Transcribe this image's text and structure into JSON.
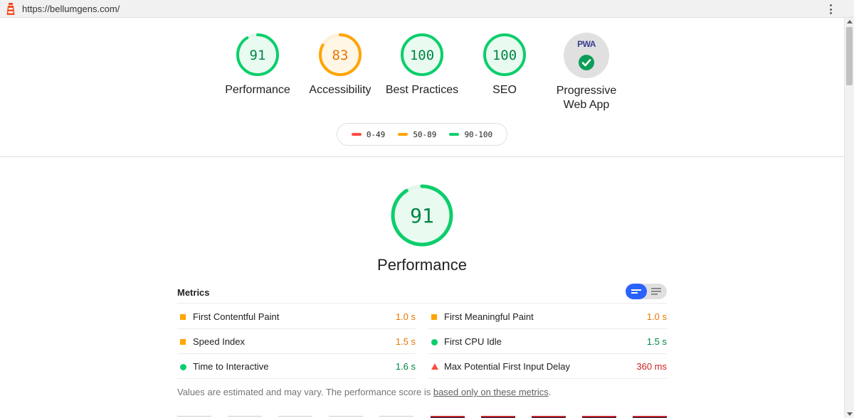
{
  "browser": {
    "url": "https://bellumgens.com/",
    "logo_icon": "lighthouse-icon",
    "menu_icon": "more-vert-icon"
  },
  "colors": {
    "pass": "#0cce6b",
    "average": "#ffa400",
    "fail": "#ff4e42",
    "pass_text": "#018642",
    "average_text": "#e67700",
    "fail_text": "#c7221f"
  },
  "categories": [
    {
      "name": "Performance",
      "score": 91,
      "status": "pass"
    },
    {
      "name": "Accessibility",
      "score": 83,
      "status": "average"
    },
    {
      "name": "Best Practices",
      "score": 100,
      "status": "pass"
    },
    {
      "name": "SEO",
      "score": 100,
      "status": "pass"
    },
    {
      "name": "Progressive Web App",
      "badge_text": "PWA",
      "status": "badge"
    }
  ],
  "legend": [
    {
      "label": "0-49",
      "status": "fail"
    },
    {
      "label": "50-89",
      "status": "average"
    },
    {
      "label": "90-100",
      "status": "pass"
    }
  ],
  "main": {
    "score": 91,
    "title": "Performance"
  },
  "metrics": {
    "title": "Metrics",
    "items": [
      {
        "name": "First Contentful Paint",
        "value": "1.0 s",
        "status": "average"
      },
      {
        "name": "First Meaningful Paint",
        "value": "1.0 s",
        "status": "average"
      },
      {
        "name": "Speed Index",
        "value": "1.5 s",
        "status": "average"
      },
      {
        "name": "First CPU Idle",
        "value": "1.5 s",
        "status": "pass"
      },
      {
        "name": "Time to Interactive",
        "value": "1.6 s",
        "status": "pass"
      },
      {
        "name": "Max Potential First Input Delay",
        "value": "360 ms",
        "status": "fail"
      }
    ]
  },
  "footnote": {
    "text": "Values are estimated and may vary. The performance score is ",
    "link": "based only on these metrics",
    "end": "."
  }
}
